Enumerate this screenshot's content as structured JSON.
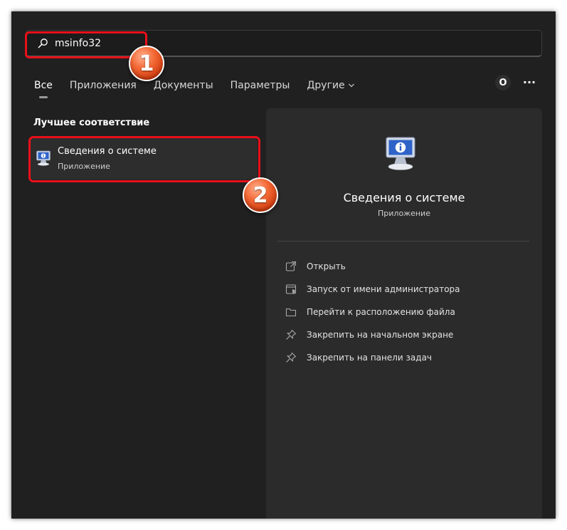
{
  "search": {
    "value": "msinfo32"
  },
  "tabs": [
    {
      "label": "Все",
      "active": true
    },
    {
      "label": "Приложения"
    },
    {
      "label": "Документы"
    },
    {
      "label": "Параметры"
    },
    {
      "label": "Другие"
    }
  ],
  "header": {
    "avatar_letter": "О",
    "more_label": "..."
  },
  "best_match": {
    "section_title": "Лучшее соответствие",
    "item_title": "Сведения о системе",
    "item_subtitle": "Приложение"
  },
  "detail": {
    "title": "Сведения о системе",
    "subtitle": "Приложение",
    "actions": [
      {
        "label": "Открыть",
        "icon": "open-icon"
      },
      {
        "label": "Запуск от имени администратора",
        "icon": "run-as-admin-icon"
      },
      {
        "label": "Перейти к расположению файла",
        "icon": "folder-icon"
      },
      {
        "label": "Закрепить на начальном экране",
        "icon": "pin-icon"
      },
      {
        "label": "Закрепить на панели задач",
        "icon": "pin-icon"
      }
    ]
  },
  "annotations": {
    "step1": "1",
    "step2": "2"
  },
  "colors": {
    "window_bg": "#202020",
    "panel_bg": "#2b2b2b",
    "highlight": "#e8101a",
    "badge": "#f46a36"
  }
}
